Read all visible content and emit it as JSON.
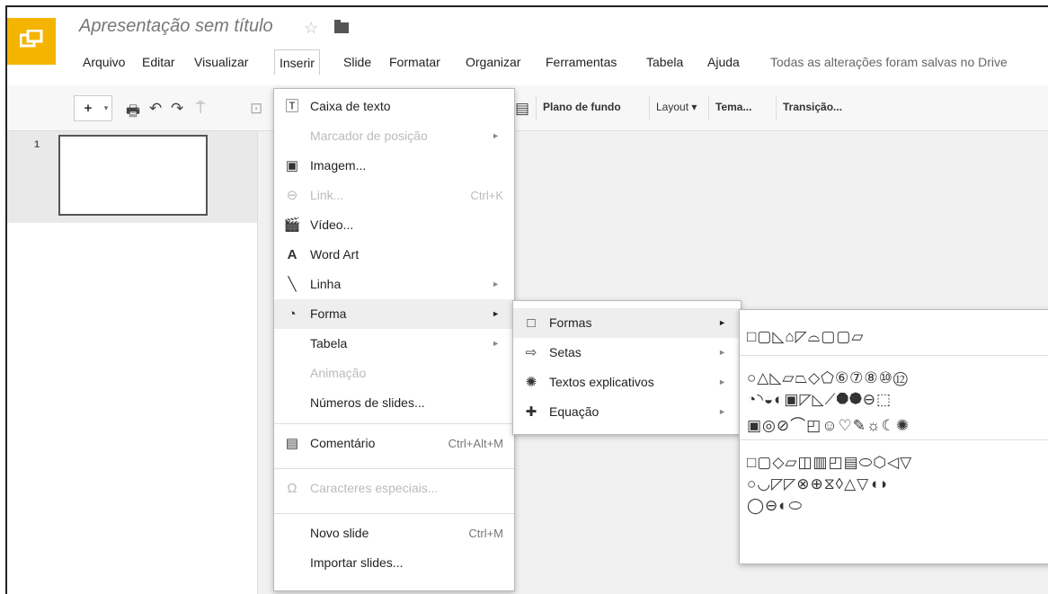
{
  "app": {
    "title": "Apresentação sem título",
    "save_status": "Todas as alterações foram salvas no Drive"
  },
  "menubar": [
    "Arquivo",
    "Editar",
    "Visualizar",
    "Inserir",
    "Slide",
    "Formatar",
    "Organizar",
    "Ferramentas",
    "Tabela",
    "Ajuda"
  ],
  "toolbar": {
    "new": "+",
    "buttons": [
      "Plano de fundo",
      "Layout ▾",
      "Tema...",
      "Transição..."
    ]
  },
  "slides": [
    {
      "number": "1"
    }
  ],
  "insert_menu": {
    "items": [
      {
        "label": "Caixa de texto",
        "icon": "text-box-icon",
        "disabled": false
      },
      {
        "label": "Marcador de posição",
        "disabled": true,
        "submenu": true
      },
      {
        "label": "Imagem...",
        "icon": "image-icon",
        "disabled": false
      },
      {
        "label": "Link...",
        "icon": "link-icon",
        "disabled": true,
        "shortcut": "Ctrl+K"
      },
      {
        "label": "Vídeo...",
        "icon": "video-icon",
        "disabled": false
      },
      {
        "label": "Word Art",
        "icon": "word-art-icon",
        "disabled": false
      },
      {
        "label": "Linha",
        "icon": "line-icon",
        "disabled": false,
        "submenu": true
      },
      {
        "label": "Forma",
        "icon": "shape-icon",
        "disabled": false,
        "submenu": true,
        "highlighted": true
      },
      {
        "label": "Tabela",
        "disabled": false,
        "submenu": true
      },
      {
        "label": "Animação",
        "disabled": true
      },
      {
        "label": "Números de slides...",
        "disabled": false
      },
      {
        "label": "Comentário",
        "icon": "comment-icon",
        "disabled": false,
        "shortcut": "Ctrl+Alt+M"
      },
      {
        "label": "Caracteres especiais...",
        "icon": "omega-icon",
        "disabled": true
      },
      {
        "label": "Novo slide",
        "disabled": false,
        "shortcut": "Ctrl+M"
      },
      {
        "label": "Importar slides...",
        "disabled": false
      }
    ]
  },
  "forma_submenu": {
    "items": [
      {
        "label": "Formas",
        "icon": "square-icon",
        "highlighted": true
      },
      {
        "label": "Setas",
        "icon": "arrow-icon"
      },
      {
        "label": "Textos explicativos",
        "icon": "callout-icon"
      },
      {
        "label": "Equação",
        "icon": "equation-icon"
      }
    ]
  },
  "shapes_panel": {
    "row1": "□▢◺⌂◸⌓▢▢▱",
    "row2": "○△◺▱⏢◇⬠⑥⑦⑧⑩⑫",
    "row3": "◔◝◒◐▣◸◺⟋⯃⯄⊖⬚",
    "row4": "▣◎⊘⌒◰☺♡✎☼☾✺",
    "row5": "□▢◇▱◫▥◰▤⬭⬡◁▽",
    "row6": "○◡◸◸⊗⊕⧖◊△▽◖◗",
    "row7": "◯⊖◐⬭"
  }
}
